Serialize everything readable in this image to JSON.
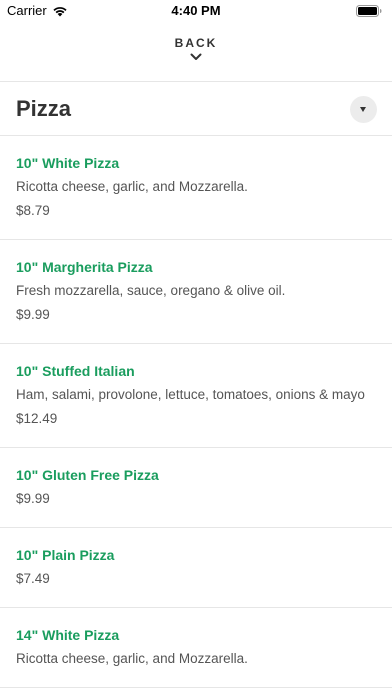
{
  "status_bar": {
    "carrier": "Carrier",
    "time": "4:40 PM"
  },
  "header": {
    "back_label": "BACK"
  },
  "category": {
    "title": "Pizza"
  },
  "menu_items": [
    {
      "name": "10\" White Pizza",
      "description": "Ricotta cheese, garlic, and Mozzarella.",
      "price": "$8.79"
    },
    {
      "name": "10\" Margherita Pizza",
      "description": "Fresh mozzarella, sauce, oregano & olive oil.",
      "price": "$9.99"
    },
    {
      "name": "10\" Stuffed Italian",
      "description": "Ham, salami, provolone, lettuce, tomatoes, onions & mayo",
      "price": "$12.49"
    },
    {
      "name": "10\" Gluten Free Pizza",
      "price": "$9.99"
    },
    {
      "name": "10\" Plain Pizza",
      "price": "$7.49"
    },
    {
      "name": "14\" White Pizza",
      "description": "Ricotta cheese, garlic, and Mozzarella."
    }
  ],
  "icons": {
    "wifi": "wifi-icon",
    "battery": "battery-icon",
    "back": "chevron-down-icon",
    "dropdown": "caret-down-icon"
  },
  "colors": {
    "accent": "#1a9d5e",
    "text_primary": "#333333",
    "text_secondary": "#555555",
    "divider": "#e6e6e6"
  }
}
